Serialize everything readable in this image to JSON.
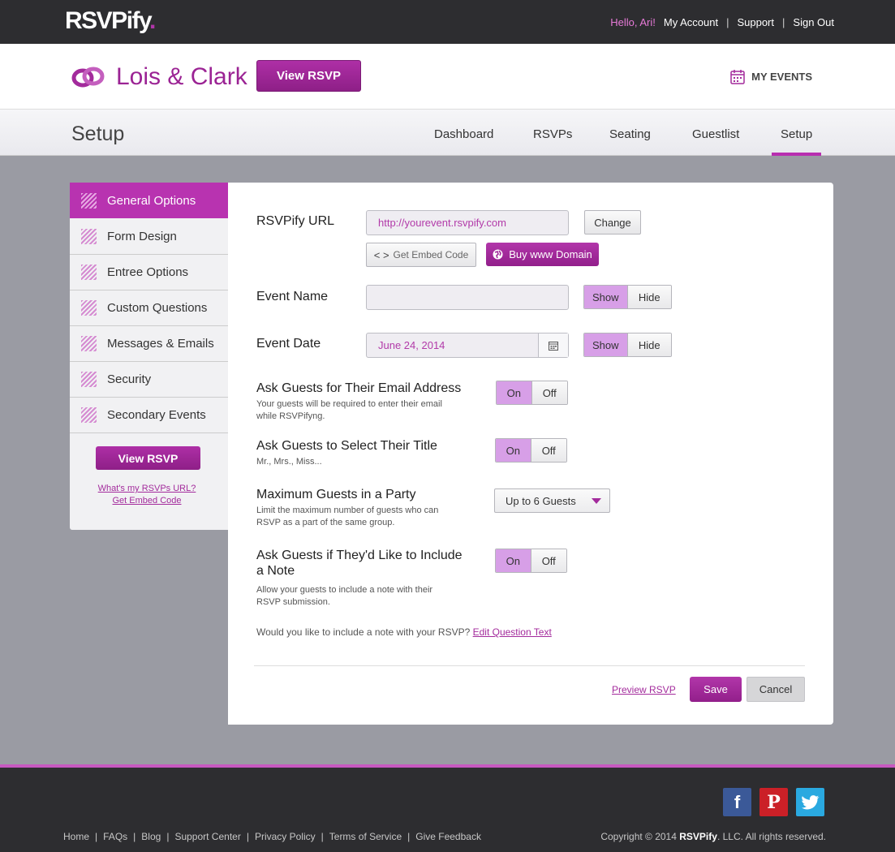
{
  "topbar": {
    "logo": "RSVPify",
    "logo_dot": ".",
    "hello": "Hello, Ari!",
    "my_account": "My Account",
    "support": "Support",
    "sign_out": "Sign Out",
    "sep": "|"
  },
  "event": {
    "title": "Lois & Clark",
    "view_rsvp": "View RSVP",
    "my_events": "MY EVENTS"
  },
  "section": {
    "title": "Setup",
    "tabs": [
      "Dashboard",
      "RSVPs",
      "Seating",
      "Guestlist",
      "Setup"
    ],
    "active_tab": "Setup"
  },
  "sidebar": {
    "items": [
      "General Options",
      "Form Design",
      "Entree Options",
      "Custom Questions",
      "Messages & Emails",
      "Security",
      "Secondary Events"
    ],
    "active_item": "General Options",
    "view_rsvp": "View RSVP",
    "link_url": "What's my RSVPs URL?",
    "link_embed": "Get Embed Code"
  },
  "form": {
    "url_label": "RSVPify URL",
    "url_value": "http://yourevent.rsvpify.com",
    "change": "Change",
    "embed": "Get Embed Code",
    "embed_glyph": "< >",
    "buy_domain": "Buy www Domain",
    "event_name_label": "Event Name",
    "event_name_value": "",
    "event_date_label": "Event Date",
    "event_date_value": "June 24, 2014",
    "show": "Show",
    "hide": "Hide",
    "on": "On",
    "off": "Off",
    "email_label": "Ask Guests for Their Email Address",
    "email_sub_1": "Your guests will be required to enter their email",
    "email_sub_2": "while RSVPifyng.",
    "title_label": "Ask Guests to Select Their Title",
    "title_sub": "Mr., Mrs., Miss...",
    "max_label": "Maximum Guests in a Party",
    "max_sub_1": "Limit the maximum number of guests who can",
    "max_sub_2": "RSVP as a part of the same group.",
    "max_value": "Up to 6 Guests",
    "note_label_1": "Ask Guests if They'd Like to Include",
    "note_label_2": "a Note",
    "note_sub_1": "Allow your guests to include a note with their",
    "note_sub_2": "RSVP submission.",
    "note_question": "Would you like to include a note with your RSVP?",
    "edit_question": "Edit Question Text",
    "preview": "Preview RSVP",
    "save": "Save",
    "cancel": "Cancel"
  },
  "footer": {
    "links": [
      "Home",
      "FAQs",
      "Blog",
      "Support Center",
      "Privacy Policy",
      "Terms of Service",
      "Give Feedback"
    ],
    "sep": "|",
    "copyright_pre": "Copyright © 2014",
    "copyright_brand": "RSVPify",
    "copyright_post": ". LLC. All rights reserved.",
    "social": {
      "facebook": "f",
      "pinterest": "P"
    }
  },
  "colors": {
    "brand": "#a32b9c",
    "accent": "#b833b0",
    "toggle_on": "#d79fe7"
  }
}
